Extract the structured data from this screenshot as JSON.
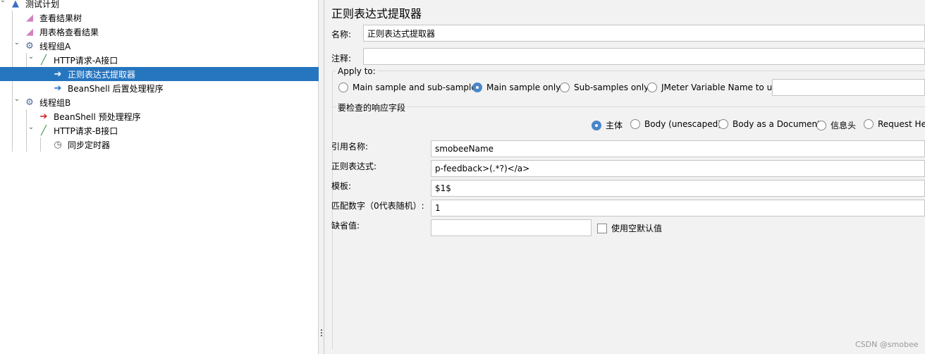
{
  "tree": [
    {
      "label": "测试计划",
      "level": 0,
      "icon": "flask-icon",
      "expanded": true
    },
    {
      "label": "查看结果树",
      "level": 1,
      "icon": "graph-icon"
    },
    {
      "label": "用表格查看结果",
      "level": 1,
      "icon": "graph-icon"
    },
    {
      "label": "线程组A",
      "level": 1,
      "icon": "gear-icon",
      "expanded": true
    },
    {
      "label": "HTTP请求-A接口",
      "level": 2,
      "icon": "pipette-icon",
      "expanded": true
    },
    {
      "label": "正则表达式提取器",
      "level": 3,
      "icon": "post-processor-icon",
      "selected": true
    },
    {
      "label": "BeanShell 后置处理程序",
      "level": 3,
      "icon": "post-processor-icon"
    },
    {
      "label": "线程组B",
      "level": 1,
      "icon": "gear-icon",
      "expanded": true
    },
    {
      "label": "BeanShell 预处理程序",
      "level": 2,
      "icon": "pre-processor-icon"
    },
    {
      "label": "HTTP请求-B接口",
      "level": 2,
      "icon": "pipette-icon",
      "expanded": true
    },
    {
      "label": "同步定时器",
      "level": 3,
      "icon": "timer-icon"
    }
  ],
  "panel": {
    "title": "正则表达式提取器",
    "name_label": "名称:",
    "name_value": "正则表达式提取器",
    "comment_label": "注释:",
    "comment_value": "",
    "apply_to": {
      "legend": "Apply to:",
      "options": [
        "Main sample and sub-samples",
        "Main sample only",
        "Sub-samples only",
        "JMeter Variable Name to use"
      ],
      "selected": 1,
      "var_value": ""
    },
    "field": {
      "legend": "要检查的响应字段",
      "options": [
        "主体",
        "Body (unescaped)",
        "Body as a Document",
        "信息头",
        "Request Headers"
      ],
      "selected": 0
    },
    "ref_label": "引用名称:",
    "ref_value": "smobeeName",
    "regex_label": "正则表达式:",
    "regex_value": "p-feedback>(.*?)</a>",
    "template_label": "模板:",
    "template_value": "$1$",
    "match_label": "匹配数字（0代表随机）:",
    "match_value": "1",
    "default_label": "缺省值:",
    "default_value": "",
    "empty_default_label": "使用空默认值",
    "empty_default_checked": false
  },
  "watermark": "CSDN @smobee",
  "colors": {
    "selection": "#2675bf",
    "radio": "#4a86c8"
  }
}
